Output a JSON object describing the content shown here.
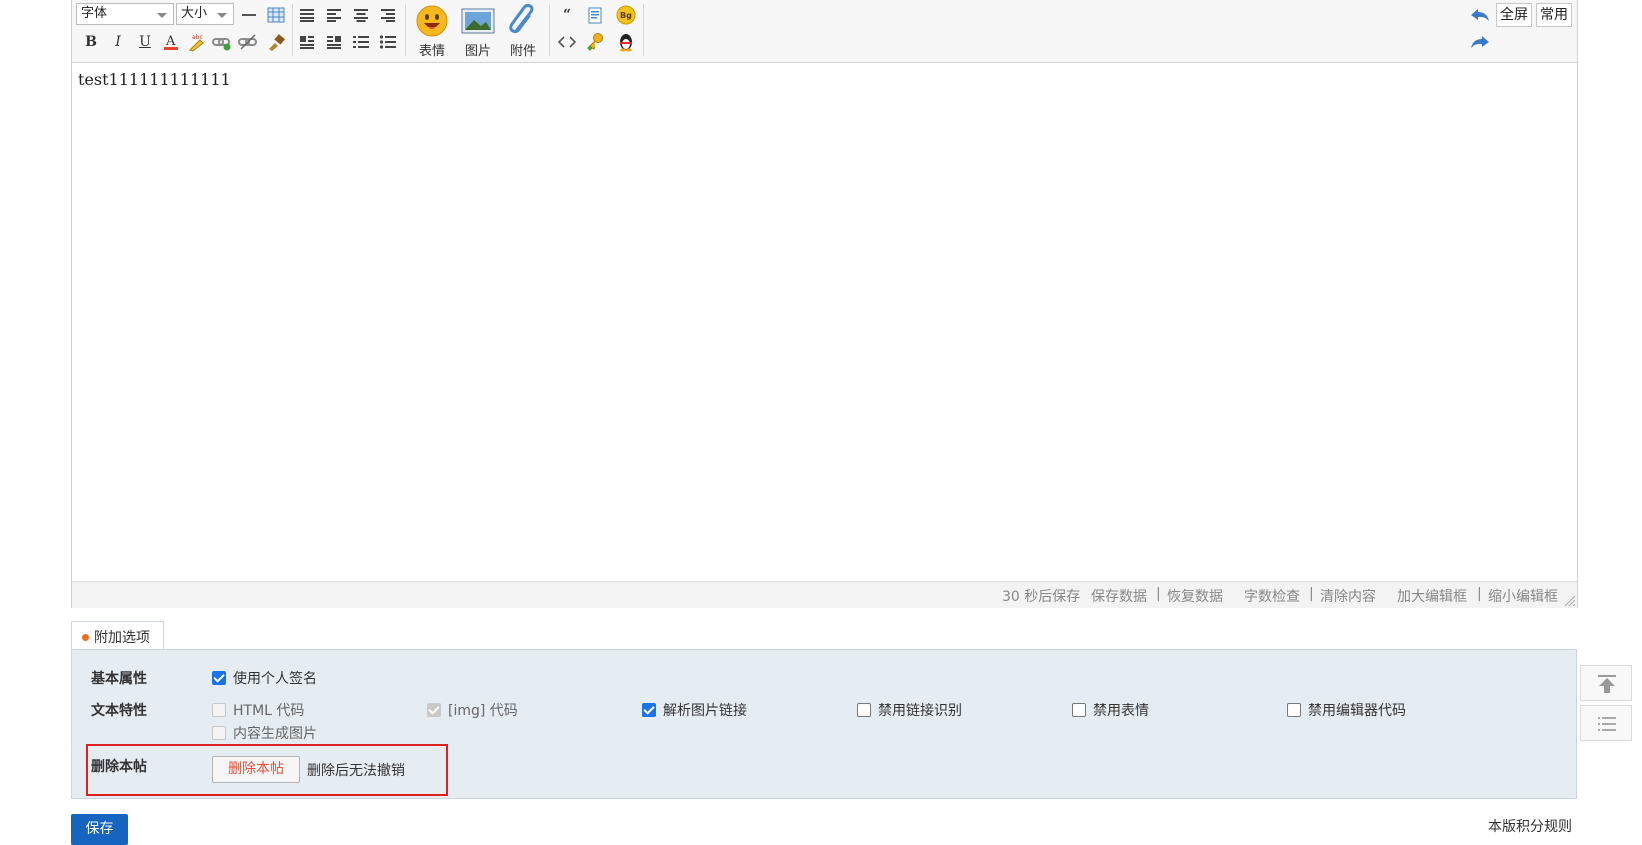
{
  "toolbar": {
    "font_select": "字体",
    "size_select": "大小",
    "emoji_label": "表情",
    "image_label": "图片",
    "attach_label": "附件",
    "fullscreen_label": "全屏",
    "common_label": "常用"
  },
  "editor": {
    "content": "test111111111111"
  },
  "statusbar": {
    "autosave": "30 秒后保存",
    "save_data": "保存数据",
    "restore_data": "恢复数据",
    "word_check": "字数检查",
    "clear_content": "清除内容",
    "enlarge": "加大编辑框",
    "shrink": "缩小编辑框",
    "sep": "|"
  },
  "options": {
    "tab_label": "附加选项",
    "basic_label": "基本属性",
    "use_signature": "使用个人签名",
    "text_label": "文本特性",
    "html_code": "HTML 代码",
    "img_code": "[img] 代码",
    "parse_image_links": "解析图片链接",
    "disable_link_detect": "禁用链接识别",
    "disable_emoji": "禁用表情",
    "disable_editor_code": "禁用编辑器代码",
    "content_to_image": "内容生成图片",
    "delete_label": "删除本帖",
    "delete_button": "删除本帖",
    "delete_note": "删除后无法撤销"
  },
  "footer": {
    "save_button": "保存",
    "rules_link": "本版积分规则"
  },
  "colors": {
    "accent": "#1565c0",
    "danger": "#e02020",
    "panel_bg": "#e5ecf2"
  }
}
